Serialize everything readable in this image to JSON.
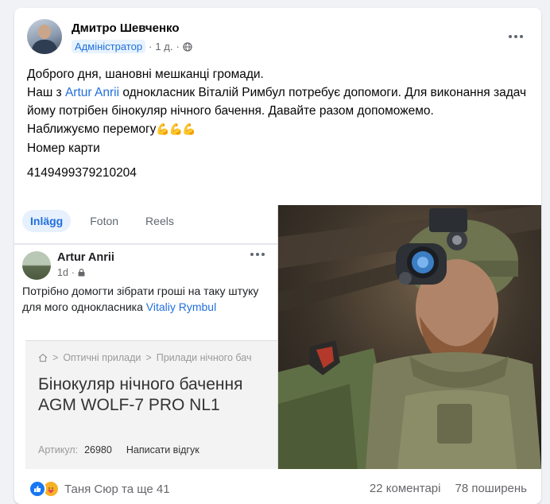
{
  "post": {
    "author": "Дмитро Шевченко",
    "role": "Адміністратор",
    "time": "1 д.",
    "separator": "·",
    "text": {
      "line1": "Доброго дня, шановні мешканці громади.",
      "line2_start": "Наш з ",
      "line2_link": "Artur Anrii",
      "line2_rest": " однокласник  Віталій Римбул потребує допомоги. Для виконання задач йому потрібен бінокуляр нічного бачення. Давайте разом допоможемо.",
      "line3": "Наближуємо перемогу",
      "line3_emoji": "💪💪💪",
      "line4": "Номер карти",
      "card_number": "4149499379210204"
    }
  },
  "embedded_post": {
    "tabs": [
      "Inlägg",
      "Foton",
      "Reels"
    ],
    "author": "Artur Anrii",
    "time": "1d",
    "separator": "·",
    "text_start": "Потрібно домогти зібрати гроші на таку штуку для мого однокласника ",
    "text_link": "Vitaliy Rymbul",
    "product": {
      "breadcrumb_1": "Оптичні прилади",
      "breadcrumb_2": "Прилади нічного бач",
      "breadcrumb_sep": ">",
      "title": "Бінокуляр нічного бачення AGM WOLF-7 PRO NL1",
      "sku_label": "Артикул:",
      "sku_value": "26980",
      "review_link": "Написати відгук"
    }
  },
  "footer": {
    "reaction_names": "Таня Сюр та ще 41",
    "comments": "22 коментарі",
    "shares": "78 поширень"
  },
  "colors": {
    "link": "#216fdb",
    "like_blue": "#1877f2",
    "care_yellow": "#f7b125",
    "background": "#f0f2f5"
  },
  "icons": [
    "globe-icon",
    "more-icon",
    "lock-icon",
    "home-icon",
    "like-icon",
    "care-icon"
  ]
}
